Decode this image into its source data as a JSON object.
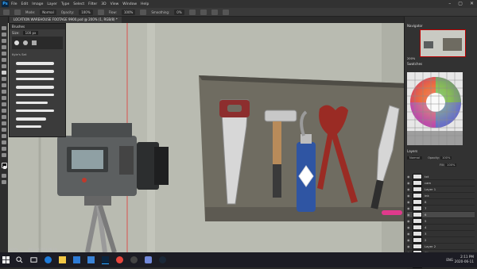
{
  "app": {
    "logo": "Ps",
    "brand_color": "#31a8ff"
  },
  "menu": [
    "File",
    "Edit",
    "Image",
    "Layer",
    "Type",
    "Select",
    "Filter",
    "3D",
    "View",
    "Window",
    "Help"
  ],
  "window_controls": {
    "minimize": "–",
    "maximize": "▢",
    "close": "✕"
  },
  "options_bar": {
    "mode_label": "Mode:",
    "mode_value": "Normal",
    "opacity_label": "Opacity:",
    "opacity_value": "100%",
    "flow_label": "Flow:",
    "flow_value": "100%",
    "smoothing_label": "Smoothing:",
    "smoothing_value": "0%"
  },
  "document_tab": {
    "title": "LOCATION WAREHOUSE FOOTAGE 9900.psd @ 200% (1, RGB/8) *"
  },
  "brushes_panel": {
    "title": "Brushes",
    "size_label": "Size:",
    "size_value": "100 px",
    "group_name": "Kyle's Set"
  },
  "navigator_panel": {
    "title": "Navigator",
    "zoom": "200%"
  },
  "swatches_panel": {
    "title": "Swatches"
  },
  "layers_panel": {
    "title": "Layers",
    "blend_mode": "Normal",
    "opacity_label": "Opacity:",
    "opacity_value": "100%",
    "fill_label": "Fill:",
    "fill_value": "100%",
    "layers": [
      {
        "name": "txt",
        "active": false
      },
      {
        "name": "cam",
        "active": false
      },
      {
        "name": "Layer 1",
        "active": false
      },
      {
        "name": "ink",
        "active": false
      },
      {
        "name": "8",
        "active": false
      },
      {
        "name": "7",
        "active": false
      },
      {
        "name": "6",
        "active": true
      },
      {
        "name": "5",
        "active": false
      },
      {
        "name": "4",
        "active": false
      },
      {
        "name": "3",
        "active": false
      },
      {
        "name": "2",
        "active": false
      },
      {
        "name": "Layer 2",
        "active": false
      },
      {
        "name": "fill",
        "active": false
      },
      {
        "name": "bg",
        "active": false
      },
      {
        "name": "Background",
        "active": false
      }
    ]
  },
  "status_bar": {
    "zoom": "200%",
    "doc_info": "Doc: 20.3M/1.98.1M"
  },
  "taskbar": {
    "search_hint": "Type here to search",
    "tray_lang": "ENG",
    "time": "2:11 PM",
    "date": "2020-06-11"
  },
  "icons": [
    "windows-start-icon",
    "search-icon",
    "task-view-icon",
    "edge-icon",
    "folder-icon",
    "store-icon",
    "mail-icon",
    "photoshop-icon",
    "chrome-icon",
    "obs-icon",
    "discord-icon",
    "steam-icon"
  ]
}
